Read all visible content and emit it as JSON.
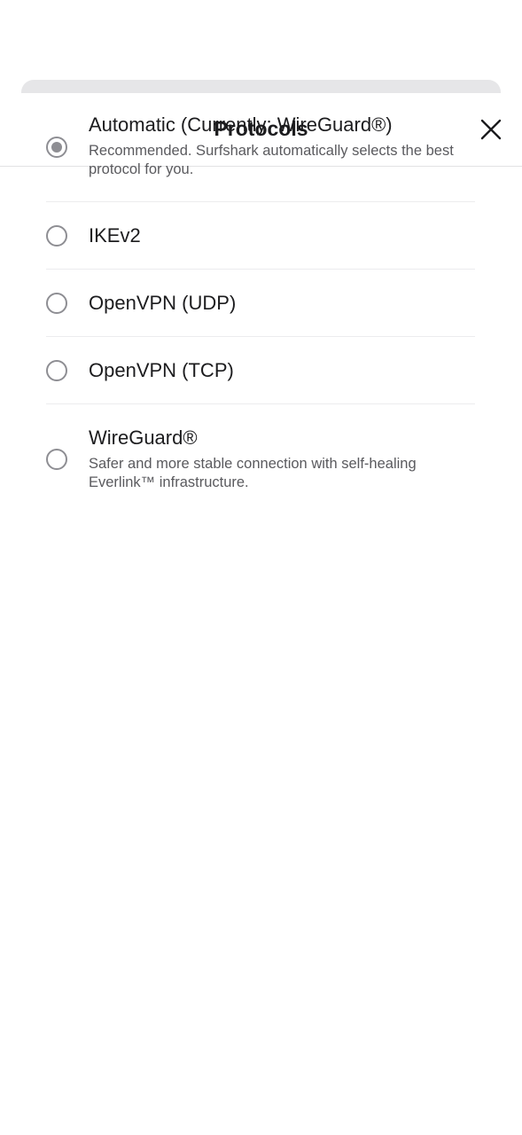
{
  "header": {
    "title": "Protocols",
    "close_icon": "close-icon"
  },
  "protocols": [
    {
      "label": "Automatic (Currently: WireGuard®)",
      "description": "Recommended. Surfshark automatically selects the best protocol for you.",
      "selected": true
    },
    {
      "label": "IKEv2",
      "description": "",
      "selected": false
    },
    {
      "label": "OpenVPN (UDP)",
      "description": "",
      "selected": false
    },
    {
      "label": "OpenVPN (TCP)",
      "description": "",
      "selected": false
    },
    {
      "label": "WireGuard®",
      "description": "Safer and more stable connection with self-healing Everlink™ infrastructure.",
      "selected": false
    }
  ],
  "colors": {
    "radio": "#8e8e93",
    "divider": "#ececee",
    "text_primary": "#1c1c1e",
    "text_secondary": "#5a5a5e"
  }
}
